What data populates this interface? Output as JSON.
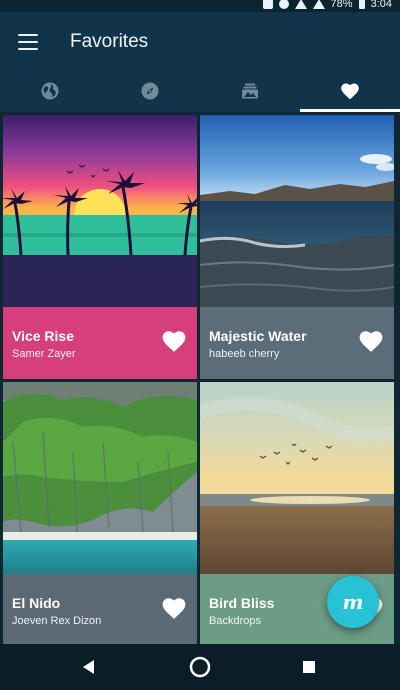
{
  "status_bar": {
    "battery": "78%",
    "time": "3:04"
  },
  "app_bar": {
    "title": "Favorites"
  },
  "tabs": [
    {
      "icon": "globe-icon"
    },
    {
      "icon": "compass-icon"
    },
    {
      "icon": "gallery-icon"
    },
    {
      "icon": "heart-icon",
      "active": true
    }
  ],
  "cards": [
    {
      "title": "Vice Rise",
      "author": "Samer Zayer",
      "caption_color": "#d73e7c"
    },
    {
      "title": "Majestic Water",
      "author": "habeeb cherry",
      "caption_color": "#5a6d79"
    },
    {
      "title": "El Nido",
      "author": "Joeven Rex Dizon",
      "caption_color": "#5b6a75"
    },
    {
      "title": "Bird Bliss",
      "author": "Backdrops",
      "caption_color": "#6c9c85"
    }
  ],
  "fab": {
    "label": "m"
  },
  "colors": {
    "app_bar": "#12344a",
    "accent": "#27c2d6"
  }
}
